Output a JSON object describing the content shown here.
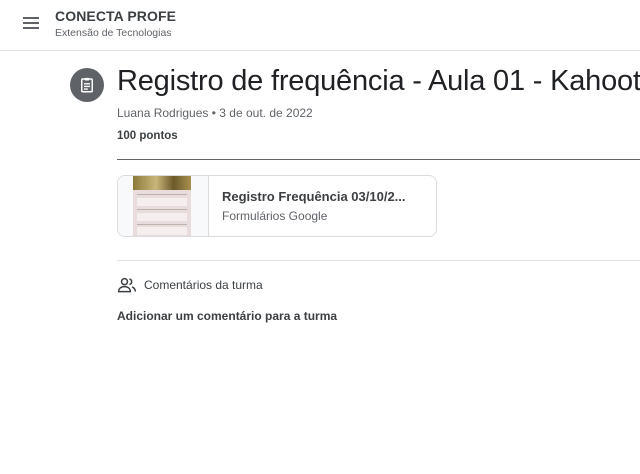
{
  "header": {
    "menu_icon": "hamburger-menu-icon",
    "class_name": "CONECTA PROFE",
    "class_subtitle": "Extensão de Tecnologias"
  },
  "assignment": {
    "icon": "assignment-icon",
    "title": "Registro de frequência - Aula 01 - Kahoot",
    "author": "Luana Rodrigues",
    "separator": "•",
    "date": "3 de out. de 2022",
    "points": "100 pontos"
  },
  "attachment": {
    "title": "Registro Frequência 03/10/2...",
    "type": "Formulários Google",
    "thumbnail": "google-form-thumbnail"
  },
  "comments": {
    "icon": "people-icon",
    "label": "Comentários da turma",
    "add_label": "Adicionar um comentário para a turma"
  },
  "colors": {
    "icon_gray": "#5f6368",
    "text_dark": "#202124",
    "divider": "#e0e0e0"
  }
}
